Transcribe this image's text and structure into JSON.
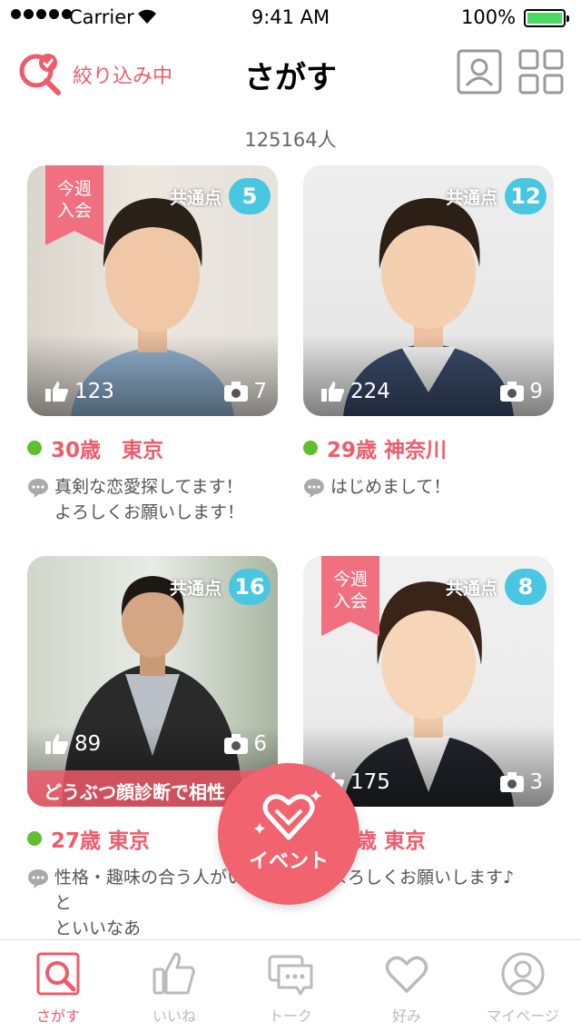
{
  "status_bar": {
    "carrier": "Carrier",
    "time": "9:41 AM",
    "battery": "100%"
  },
  "header": {
    "filter_label": "絞り込み中",
    "title": "さがす"
  },
  "member_count": "125164人",
  "common_label": "共通点",
  "new_member_label": "今週\n入会",
  "cards": [
    {
      "common_count": "5",
      "likes": "123",
      "photos": "7",
      "age_area": "30歳　東京",
      "message": "真剣な恋愛探してます！\nよろしくお願いします！",
      "new": true,
      "banner": ""
    },
    {
      "common_count": "12",
      "likes": "224",
      "photos": "9",
      "age_area": "29歳 神奈川",
      "message": "はじめまして！",
      "new": false,
      "banner": ""
    },
    {
      "common_count": "16",
      "likes": "89",
      "photos": "6",
      "age_area": "27歳 東京",
      "message": "性格・趣味の合う人がいると\nといいなあ",
      "new": false,
      "banner": "どうぶつ顔診断で相性"
    },
    {
      "common_count": "8",
      "likes": "175",
      "photos": "3",
      "age_area": "30歳 東京",
      "message": "よろしくお願いします♪",
      "new": true,
      "banner": ""
    }
  ],
  "event_button": {
    "label": "イベント"
  },
  "tabbar": {
    "items": [
      {
        "label": "さがす",
        "icon": "search-icon",
        "active": true
      },
      {
        "label": "いいね",
        "icon": "thumbs-up-icon",
        "active": false
      },
      {
        "label": "トーク",
        "icon": "chat-icon",
        "active": false
      },
      {
        "label": "好み",
        "icon": "heart-icon",
        "active": false
      },
      {
        "label": "マイページ",
        "icon": "user-icon",
        "active": false
      }
    ]
  },
  "colors": {
    "accent": "#ef5b6a",
    "badge": "#49c6e0",
    "online": "#5fbf2c"
  }
}
